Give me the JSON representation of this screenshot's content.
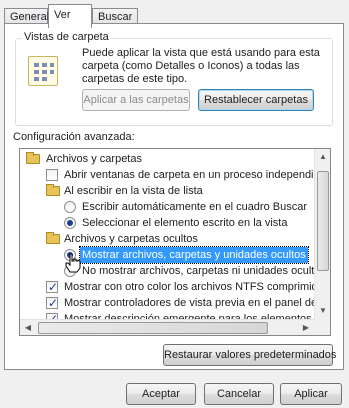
{
  "tabs": [
    {
      "label": "General"
    },
    {
      "label": "Ver"
    },
    {
      "label": "Buscar"
    }
  ],
  "folder_views": {
    "legend": "Vistas de carpeta",
    "description": "Puede aplicar la vista que está usando para esta carpeta (como Detalles o Iconos) a todas las carpetas de este tipo.",
    "apply_label": "Aplicar a las carpetas",
    "reset_label": "Restablecer carpetas"
  },
  "advanced": {
    "label": "Configuración avanzada:",
    "items": [
      {
        "label": "Archivos y carpetas"
      },
      {
        "label": "Abrir ventanas de carpeta  en un proceso independiente"
      },
      {
        "label": "Al escribir en la vista de lista"
      },
      {
        "label": "Escribir automáticamente en el cuadro Buscar"
      },
      {
        "label": "Seleccionar el elemento escrito en la vista"
      },
      {
        "label": "Archivos y carpetas ocultos"
      },
      {
        "label": "Mostrar archivos, carpetas y unidades ocultos"
      },
      {
        "label": "No mostrar archivos, carpetas ni unidades ocultos"
      },
      {
        "label": "Mostrar con otro color los archivos NTFS comprimidos o c"
      },
      {
        "label": "Mostrar controladores de vista previa en el panel de vista"
      },
      {
        "label": "Mostrar descripción emergente para los elementos de car"
      }
    ]
  },
  "restore_label": "Restaurar valores predeterminados",
  "footer": {
    "accept_label": "Aceptar",
    "cancel_label": "Cancelar",
    "apply_label": "Aplicar"
  },
  "icons": {
    "folder_view_icon": "grid-folder-icon",
    "folder_icon": "folder-icon",
    "cursor_icon": "hand-cursor-icon"
  }
}
